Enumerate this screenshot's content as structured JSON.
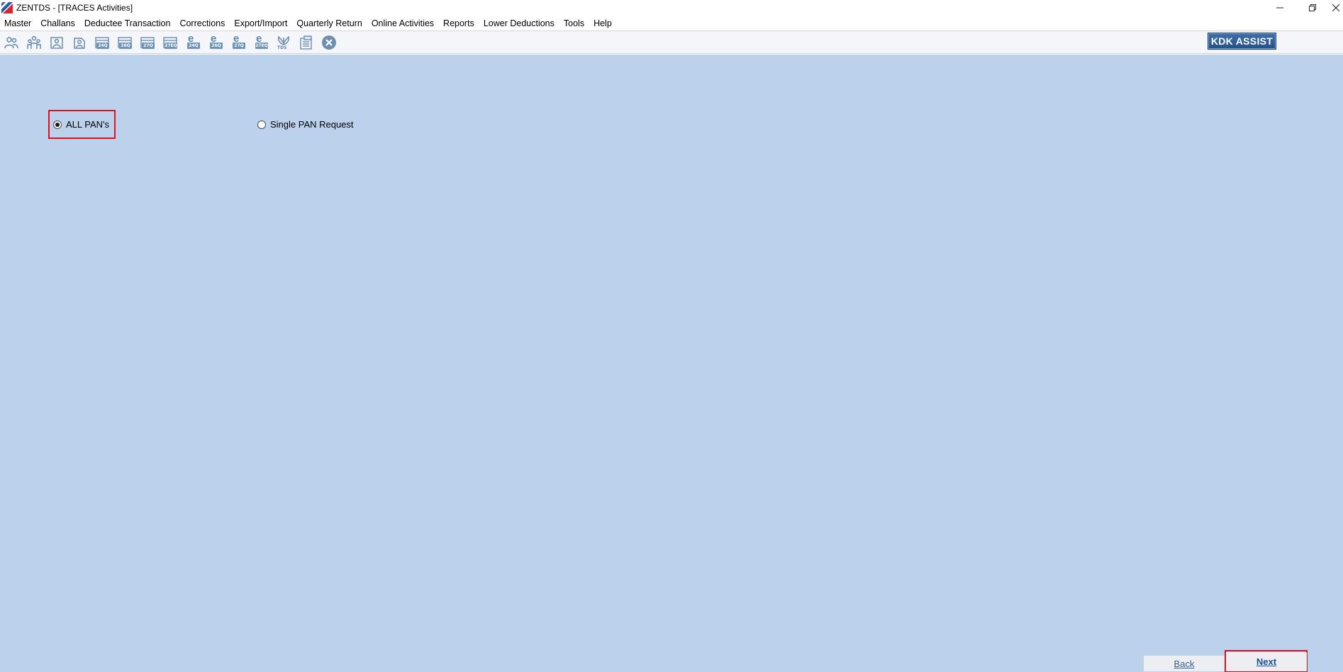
{
  "window": {
    "title": "ZENTDS - [TRACES Activities]",
    "controls": [
      "minimize-icon",
      "restore-icon",
      "close-icon"
    ]
  },
  "menu": {
    "items": [
      "Master",
      "Challans",
      "Deductee Transaction",
      "Corrections",
      "Export/Import",
      "Quarterly Return",
      "Online Activities",
      "Reports",
      "Lower Deductions",
      "Tools",
      "Help"
    ]
  },
  "toolbar": {
    "buttons": [
      {
        "icon": "persons-icon"
      },
      {
        "icon": "group-icon"
      },
      {
        "icon": "deductor-icon"
      },
      {
        "icon": "deductee-icon"
      },
      {
        "icon": "form-24q-icon",
        "tag": "24Q"
      },
      {
        "icon": "form-26q-icon",
        "tag": "26Q"
      },
      {
        "icon": "form-27q-icon",
        "tag": "27Q"
      },
      {
        "icon": "form-27eq-icon",
        "tag": "27EQ"
      },
      {
        "icon": "efile-24q-icon",
        "tag": "24Q"
      },
      {
        "icon": "efile-26q-icon",
        "tag": "26Q"
      },
      {
        "icon": "efile-27q-icon",
        "tag": "27Q"
      },
      {
        "icon": "efile-27eq-icon",
        "tag": "27EQ"
      },
      {
        "icon": "tds-icon",
        "tag": "TDS"
      },
      {
        "icon": "notes-icon"
      },
      {
        "icon": "close-circle-icon"
      }
    ],
    "assist_label": "KDK ASSIST"
  },
  "options": {
    "all_pans_label": "ALL PAN's",
    "single_pan_label": "Single PAN Request",
    "selected": "all_pans"
  },
  "nav": {
    "back_label": "Back",
    "next_label": "Next"
  },
  "colors": {
    "content_bg": "#bcd2ec",
    "highlight": "#e0101c",
    "assist_bg": "#245089"
  }
}
